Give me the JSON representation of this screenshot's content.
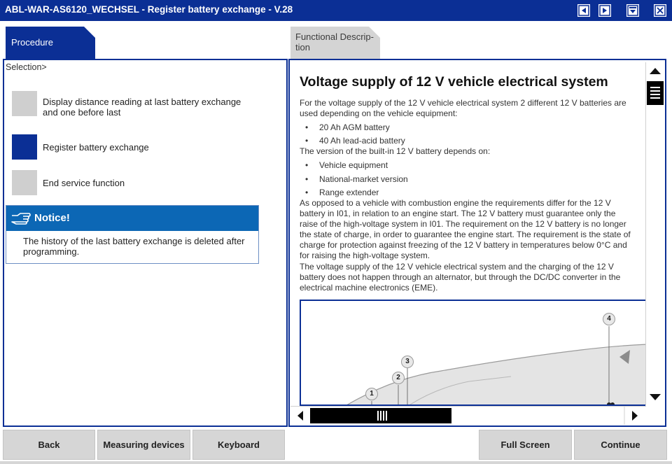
{
  "window": {
    "title": "ABL-WAR-AS6120_WECHSEL - Register battery exchange - V.28",
    "controls": [
      "prev-icon",
      "next-icon",
      "minimize-icon",
      "close-icon"
    ]
  },
  "tabs": {
    "procedure": "Procedure",
    "functional": "Functional Descrip-\ntion"
  },
  "left": {
    "selection_label": "Selection>",
    "options": [
      {
        "label": "Display distance reading at last battery exchange and one before last",
        "selected": false
      },
      {
        "label": "Register battery exchange",
        "selected": true
      },
      {
        "label": "End service function",
        "selected": false
      }
    ],
    "notice": {
      "title": "Notice!",
      "icon": "pointing-hand-icon",
      "text": "The history of the last battery exchange is deleted after programming."
    }
  },
  "doc": {
    "heading": "Voltage supply of 12 V vehicle electrical system",
    "intro": "For the voltage supply of the 12 V vehicle electrical system 2 different 12 V batteries are used depending on the vehicle equipment:",
    "batteries": [
      "20 Ah AGM battery",
      "40 Ah lead-acid battery"
    ],
    "version_intro": "The version of the built-in 12 V battery depends on:",
    "factors": [
      "Vehicle equipment",
      "National-market version",
      "Range extender"
    ],
    "para1": "As opposed to a vehicle with combustion engine the requirements differ for the 12 V battery in I01, in relation to an engine start. The 12 V battery must guarantee only the raise of the high-voltage system in I01. The requirement on the 12 V battery is no longer the state of charge, in order to guarantee the engine start. The requirement is the state of charge for protection against freezing of the 12 V battery in temperatures below 0°C and for raising the high-voltage system.",
    "para2": "The voltage supply of the 12 V vehicle electrical system and the charging of the 12 V battery does not happen through an alternator, but through the DC/DC converter in the electrical machine electronics (EME).",
    "callouts": [
      "1",
      "2",
      "3",
      "4"
    ]
  },
  "buttons": {
    "back": "Back",
    "measuring": "Measuring devices",
    "keyboard": "Keyboard",
    "fullscreen": "Full Screen",
    "continue": "Continue"
  },
  "colors": {
    "titlebar": "#0b2f95",
    "selected": "#0b2f95",
    "unselected": "#cfcfcf",
    "notice": "#0c67b5",
    "button": "#d6d6d6"
  }
}
